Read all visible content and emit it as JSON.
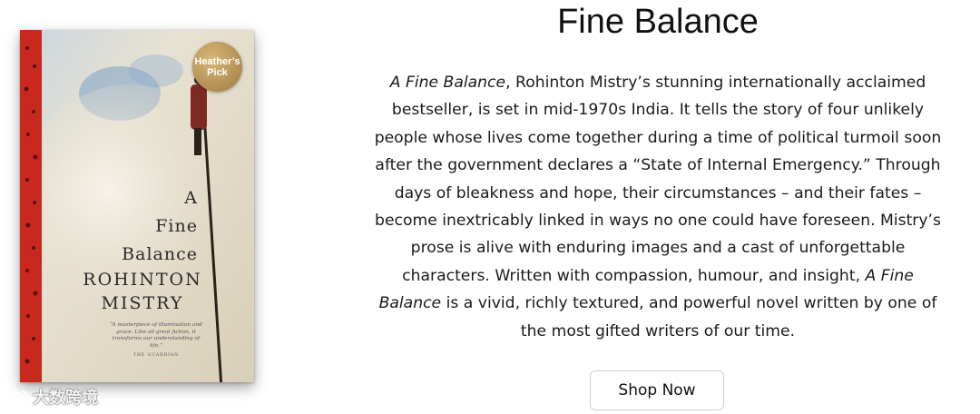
{
  "book": {
    "title": "Fine Balance",
    "cover": {
      "title_line1": "A",
      "title_line2": "Fine",
      "title_line3": "Balance",
      "author_line1": "ROHINTON",
      "author_line2": "MISTRY",
      "quote": "“A masterpiece of illumination and grace. Like all great fiction, it transforms our understanding of life.”",
      "quote_source": "THE GUARDIAN",
      "badge_line1": "Heather’s",
      "badge_line2": "Pick"
    },
    "description": {
      "p1_em": "A Fine Balance",
      "p1_rest": ", Rohinton Mistry’s stunning internationally acclaimed bestseller, is set in mid-1970s India. It tells the story of four unlikely people whose lives come together during a time of political turmoil soon after the government declares a “State of Internal Emergency.” Through days of bleakness and hope, their circumstances – and their fates – become inextricably linked in ways no one could have foreseen. Mistry’s prose is alive with enduring images and a cast of unforgettable characters. Written with compassion, humour, and insight, ",
      "p2_em": "A Fine Balance",
      "p2_rest": " is a vivid, richly textured, and powerful novel written by one of the most gifted writers of our time."
    },
    "shop_button_label": "Shop Now"
  },
  "watermark": {
    "text": "大数跨境"
  },
  "colors": {
    "badge_gold": "#b9955a",
    "spine_red": "#c8281e",
    "text_dark": "#111111"
  }
}
